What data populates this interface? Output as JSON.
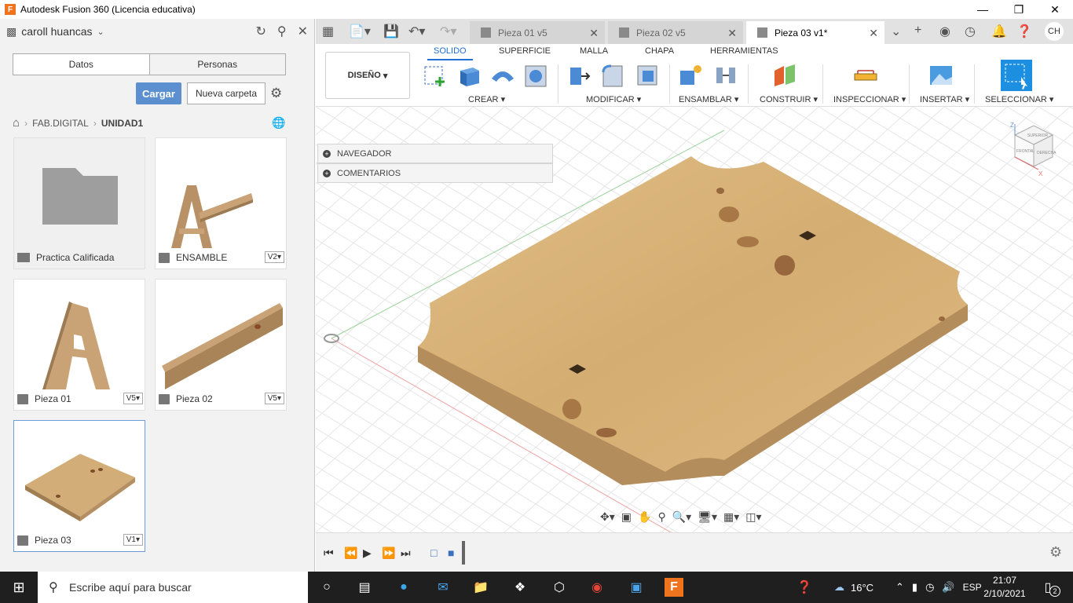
{
  "window": {
    "title": "Autodesk Fusion 360 (Licencia educativa)",
    "app_icon": "F"
  },
  "left_panel": {
    "user": "caroll huancas",
    "tabs": [
      "Datos",
      "Personas"
    ],
    "upload_label": "Cargar",
    "new_folder_label": "Nueva carpeta",
    "breadcrumb": [
      "FAB.DIGITAL",
      "UNIDAD1"
    ],
    "items": [
      {
        "name": "Practica Calificada",
        "type": "folder",
        "version": ""
      },
      {
        "name": "ENSAMBLE",
        "type": "design",
        "version": "V2"
      },
      {
        "name": "Pieza 01",
        "type": "design",
        "version": "V5"
      },
      {
        "name": "Pieza 02",
        "type": "design",
        "version": "V5"
      },
      {
        "name": "Pieza 03",
        "type": "design",
        "version": "V1"
      }
    ]
  },
  "doc_tabs": [
    {
      "label": "Pieza 01 v5",
      "active": false
    },
    {
      "label": "Pieza 02 v5",
      "active": false
    },
    {
      "label": "Pieza 03 v1*",
      "active": true
    }
  ],
  "user_initials": "CH",
  "toolbar": {
    "workspace": "DISEÑO",
    "tabs": [
      "SOLIDO",
      "SUPERFICIE",
      "MALLA",
      "CHAPA",
      "HERRAMIENTAS"
    ],
    "groups": [
      "CREAR",
      "MODIFICAR",
      "ENSAMBLAR",
      "CONSTRUIR",
      "INSPECCIONAR",
      "INSERTAR",
      "SELECCIONAR"
    ]
  },
  "browser": {
    "rows": [
      "NAVEGADOR",
      "COMENTARIOS"
    ]
  },
  "viewcube": {
    "top": "SUPERIOR",
    "front": "FRONTAL",
    "right": "DERECHA",
    "axis_z": "Z",
    "axis_x": "X"
  },
  "taskbar": {
    "search_placeholder": "Escribe aquí para buscar",
    "temperature": "16°C",
    "lang": "ESP",
    "time": "21:07",
    "date": "2/10/2021",
    "notifications": "2"
  },
  "colors": {
    "accent": "#1f6fd6",
    "upload_button": "#5b8fd0",
    "wood": "#d9b377",
    "app_orange": "#f0731e"
  }
}
